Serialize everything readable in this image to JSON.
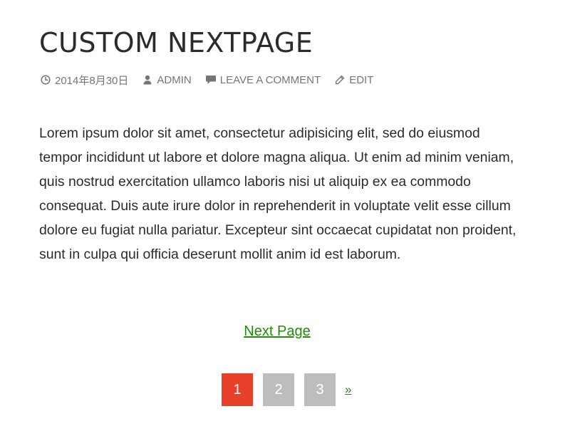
{
  "post": {
    "title": "CUSTOM NEXTPAGE",
    "meta": {
      "date": "2014年8月30日",
      "author": "ADMIN",
      "comment": "LEAVE A COMMENT",
      "edit": "EDIT"
    },
    "body": "Lorem ipsum dolor sit amet, consectetur adipisicing elit, sed do eiusmod tempor incididunt ut labore et dolore magna aliqua. Ut enim ad minim veniam, quis nostrud exercitation ullamco laboris nisi ut aliquip ex ea commodo consequat. Duis aute irure dolor in reprehenderit in voluptate velit esse cillum dolore eu fugiat nulla pariatur. Excepteur sint occaecat cupidatat non proident, sunt in culpa qui officia deserunt mollit anim id est laborum."
  },
  "next_page_link": "Next Page",
  "pagination": {
    "pages": [
      "1",
      "2",
      "3"
    ],
    "current": "1",
    "next_label": "»"
  },
  "colors": {
    "accent": "#e8412b",
    "link": "#24890d",
    "inactive_page": "#bdbdbd",
    "meta_text": "#767676",
    "body_text": "#2b2b2b"
  },
  "icons": {
    "date": "clock-icon",
    "author": "user-icon",
    "comment": "comment-icon",
    "edit": "pencil-icon"
  }
}
